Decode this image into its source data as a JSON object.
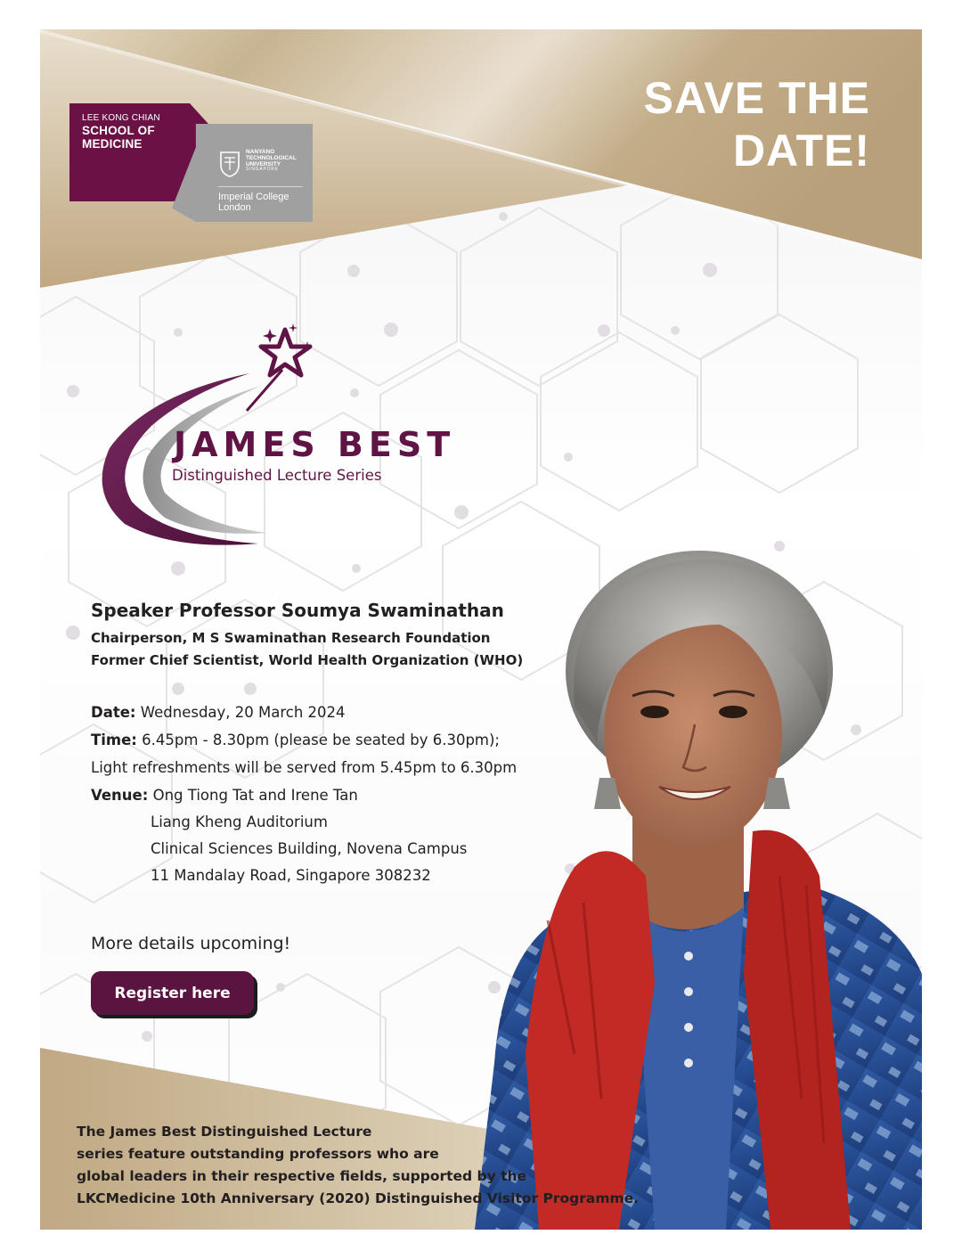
{
  "header": {
    "save_line1": "SAVE THE",
    "save_line2": "DATE!"
  },
  "logo": {
    "school_line1": "LEE KONG CHIAN",
    "school_line2": "SCHOOL OF",
    "school_line3": "MEDICINE",
    "ntu_line1": "NANYANG",
    "ntu_line2": "TECHNOLOGICAL",
    "ntu_line3": "UNIVERSITY",
    "ntu_line4": "SINGAPORE",
    "icl_line1": "Imperial College",
    "icl_line2": "London"
  },
  "series": {
    "title": "JAMES BEST",
    "subtitle": "Distinguished Lecture Series"
  },
  "speaker": {
    "heading": "Speaker Professor Soumya Swaminathan",
    "role1": "Chairperson, M S Swaminathan Research Foundation",
    "role2": "Former Chief Scientist, World Health Organization (WHO)"
  },
  "event": {
    "date_label": "Date:",
    "date_value": " Wednesday, 20 March 2024",
    "time_label": "Time:",
    "time_value": " 6.45pm - 8.30pm (please be seated by 6.30pm);",
    "refreshments": "Light refreshments will be served from 5.45pm to 6.30pm",
    "venue_label": "Venue:",
    "venue_line1": " Ong Tiong Tat and Irene Tan",
    "venue_line2": "Liang Kheng Auditorium",
    "venue_line3": "Clinical Sciences Building, Novena Campus",
    "venue_line4": "11 Mandalay Road, Singapore 308232"
  },
  "more_details": "More details upcoming!",
  "register_button": "Register here",
  "footer": {
    "line1": "The James Best Distinguished Lecture",
    "line2": "series feature outstanding professors who are",
    "line3": "global leaders in their respective fields, supported by the",
    "line4": "LKCMedicine 10th Anniversary (2020) Distinguished Visitor Programme."
  },
  "colors": {
    "brand_purple": "#6b1145",
    "gold": "#c2ad8c",
    "scarf_red": "#c12a25",
    "shirt_blue": "#24498f"
  }
}
